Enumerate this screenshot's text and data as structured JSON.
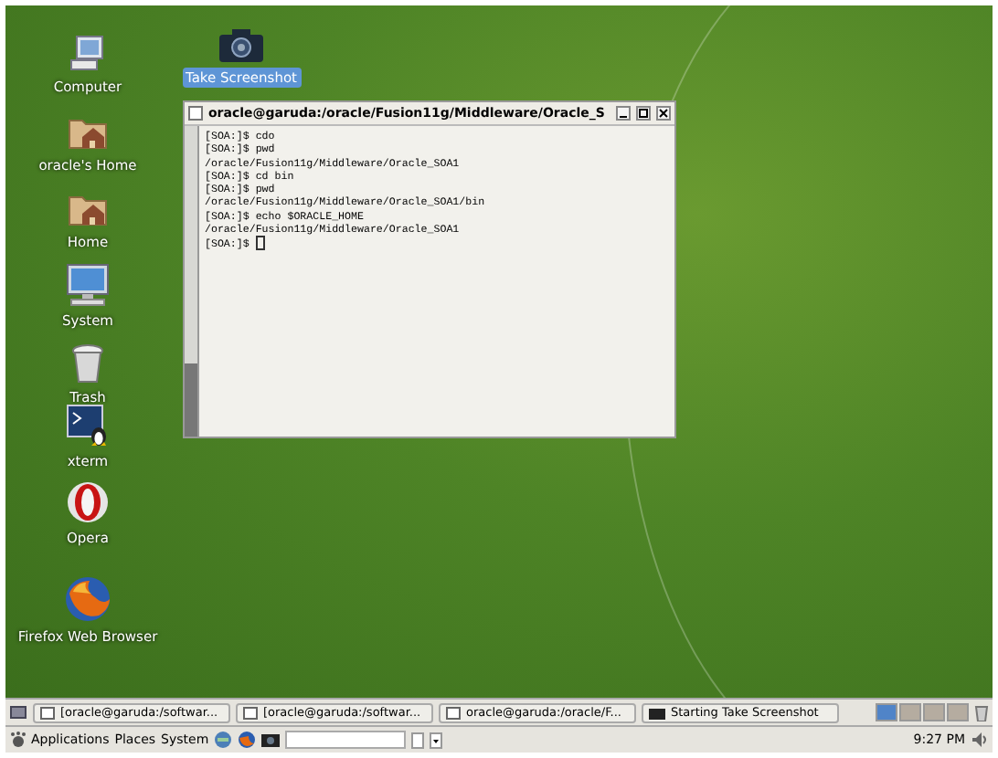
{
  "desktop_icons": [
    {
      "label": "Computer",
      "kind": "computer",
      "selected": false
    },
    {
      "label": "oracle's Home",
      "kind": "home-folder",
      "selected": false
    },
    {
      "label": "Home",
      "kind": "home-folder",
      "selected": false
    },
    {
      "label": "System",
      "kind": "monitor",
      "selected": false
    },
    {
      "label": "Trash",
      "kind": "trash",
      "selected": false
    },
    {
      "label": "xterm",
      "kind": "terminal",
      "selected": false
    },
    {
      "label": "Opera",
      "kind": "opera",
      "selected": false
    },
    {
      "label": "Firefox Web Browser",
      "kind": "firefox",
      "selected": false
    },
    {
      "label": "Take Screenshot",
      "kind": "camera",
      "selected": true
    }
  ],
  "terminal": {
    "title": "oracle@garuda:/oracle/Fusion11g/Middleware/Oracle_S",
    "lines": [
      "[SOA:]$ cdo",
      "[SOA:]$ pwd",
      "/oracle/Fusion11g/Middleware/Oracle_SOA1",
      "[SOA:]$ cd bin",
      "[SOA:]$ pwd",
      "/oracle/Fusion11g/Middleware/Oracle_SOA1/bin",
      "[SOA:]$ echo $ORACLE_HOME",
      "/oracle/Fusion11g/Middleware/Oracle_SOA1",
      "[SOA:]$ "
    ]
  },
  "taskbar": {
    "tasks": [
      {
        "label": "[oracle@garuda:/softwar...",
        "kind": "window"
      },
      {
        "label": "[oracle@garuda:/softwar...",
        "kind": "window"
      },
      {
        "label": "oracle@garuda:/oracle/F...",
        "kind": "window"
      },
      {
        "label": "Starting Take Screenshot",
        "kind": "camera"
      }
    ],
    "workspaces": [
      {
        "selected": true
      },
      {
        "selected": false
      },
      {
        "selected": false
      },
      {
        "selected": false
      }
    ]
  },
  "panel": {
    "menus": [
      "Applications",
      "Places",
      "System"
    ],
    "clock": "9:27 PM"
  }
}
